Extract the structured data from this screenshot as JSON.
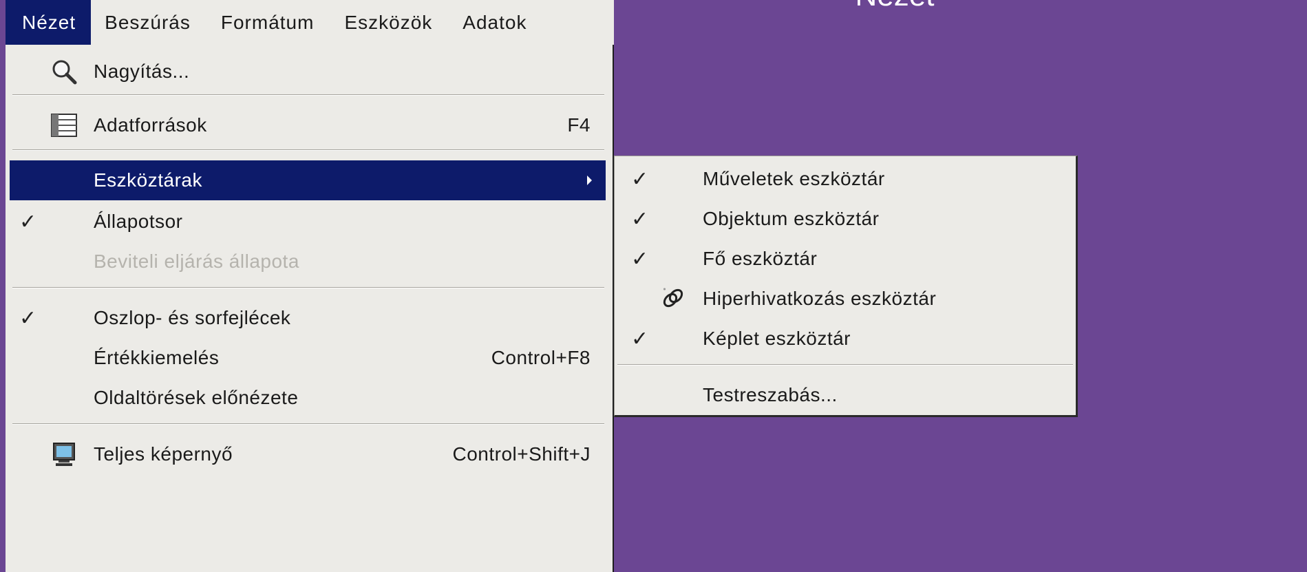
{
  "slide": {
    "title": "Nézet"
  },
  "menubar": {
    "items": [
      {
        "label": "Nézet"
      },
      {
        "label": "Beszúrás"
      },
      {
        "label": "Formátum"
      },
      {
        "label": "Eszközök"
      },
      {
        "label": "Adatok"
      }
    ]
  },
  "menu": {
    "items": [
      {
        "label": "Nagyítás...",
        "icon": "magnifier-icon"
      },
      {
        "label": "Adatforrások",
        "shortcut": "F4",
        "icon": "datasource-icon"
      },
      {
        "label": "Eszköztárak",
        "submenu": true,
        "highlighted": true
      },
      {
        "label": "Állapotsor",
        "checked": true
      },
      {
        "label": "Beviteli eljárás állapota",
        "disabled": true
      },
      {
        "label": "Oszlop- és sorfejlécek",
        "checked": true
      },
      {
        "label": "Értékkiemelés",
        "shortcut": "Control+F8"
      },
      {
        "label": "Oldaltörések előnézete"
      },
      {
        "label": "Teljes képernyő",
        "shortcut": "Control+Shift+J",
        "icon": "monitor-icon"
      }
    ]
  },
  "submenu": {
    "items": [
      {
        "label": "Műveletek eszköztár",
        "checked": true
      },
      {
        "label": "Objektum eszköztár",
        "checked": true
      },
      {
        "label": "Fő eszköztár",
        "checked": true
      },
      {
        "label": "Hiperhivatkozás eszköztár",
        "icon": "hyperlink-icon"
      },
      {
        "label": "Képlet eszköztár",
        "checked": true
      },
      {
        "label": "Testreszabás..."
      }
    ]
  },
  "icons": {
    "check": "✓"
  },
  "colors": {
    "background": "#6b4693",
    "menu": "#ecebe7",
    "highlight": "#0d1b6a"
  }
}
